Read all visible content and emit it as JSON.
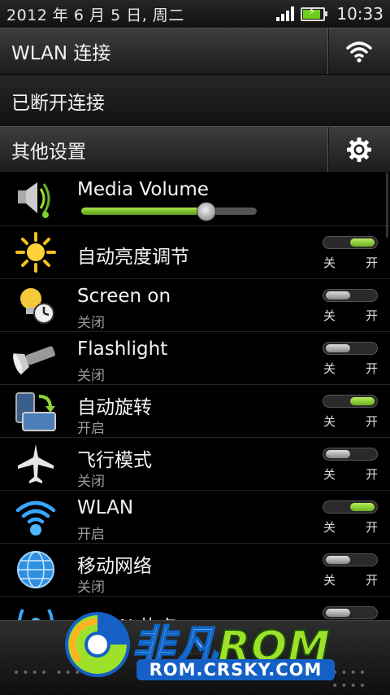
{
  "status_bar": {
    "date": "2012 年 6 月 5 日, 周二",
    "time": "10:33"
  },
  "wlan_header": {
    "label": "WLAN 连接",
    "icon": "wifi-icon"
  },
  "disconnected": {
    "label": "已断开连接"
  },
  "other_settings": {
    "label": "其他设置",
    "icon": "gear-icon"
  },
  "media_volume": {
    "label": "Media Volume",
    "level_fraction": 0.71
  },
  "toggle_labels": {
    "off": "关",
    "on": "开"
  },
  "items": [
    {
      "id": "auto-brightness",
      "title": "自动亮度调节",
      "subtitle": "",
      "on": true,
      "icon": "sun-icon"
    },
    {
      "id": "screen-on",
      "title": "Screen on",
      "subtitle": "关闭",
      "on": false,
      "icon": "bulb-clock-icon"
    },
    {
      "id": "flashlight",
      "title": "Flashlight",
      "subtitle": "关闭",
      "on": false,
      "icon": "flashlight-icon"
    },
    {
      "id": "auto-rotate",
      "title": "自动旋转",
      "subtitle": "开启",
      "on": true,
      "icon": "rotate-icon"
    },
    {
      "id": "airplane-mode",
      "title": "飞行模式",
      "subtitle": "关闭",
      "on": false,
      "icon": "airplane-icon"
    },
    {
      "id": "wlan",
      "title": "WLAN",
      "subtitle": "开启",
      "on": true,
      "icon": "wlan-icon"
    },
    {
      "id": "mobile-network",
      "title": "移动网络",
      "subtitle": "关闭",
      "on": false,
      "icon": "globe-icon"
    },
    {
      "id": "wifi-hotspot",
      "title": "WLAN 热点",
      "subtitle": "",
      "on": false,
      "icon": "hotspot-icon"
    }
  ],
  "watermark": {
    "brand_cn": "非凡",
    "brand_en": "ROM",
    "site": "ROM.CRSKY.COM"
  },
  "colors": {
    "toggle_on": "#8fd33a",
    "toggle_off": "#bbbbbb",
    "watermark_blue": "#1460c5"
  }
}
